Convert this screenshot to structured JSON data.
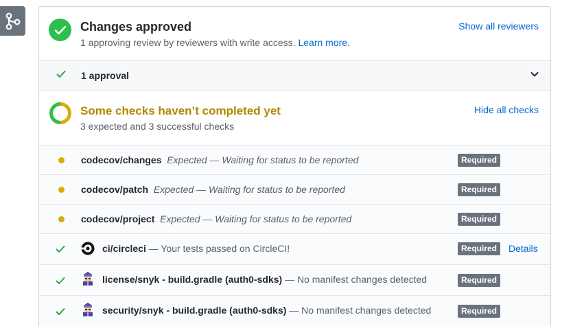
{
  "approved": {
    "title": "Changes approved",
    "subtitle": "1 approving review by reviewers with write access.",
    "learn_more": "Learn more.",
    "action": "Show all reviewers"
  },
  "approvals": {
    "label": "1 approval"
  },
  "checks": {
    "title": "Some checks haven’t completed yet",
    "subtitle": "3 expected and 3 successful checks",
    "action": "Hide all checks",
    "items": [
      {
        "status": "pending",
        "name": "codecov/changes",
        "desc": "Expected — Waiting for status to be reported",
        "badge": "Required"
      },
      {
        "status": "pending",
        "name": "codecov/patch",
        "desc": "Expected — Waiting for status to be reported",
        "badge": "Required"
      },
      {
        "status": "pending",
        "name": "codecov/project",
        "desc": "Expected — Waiting for status to be reported",
        "badge": "Required"
      },
      {
        "status": "success",
        "icon": "circleci-icon",
        "name": "ci/circleci",
        "desc": "— Your tests passed on CircleCI!",
        "badge": "Required",
        "link": "Details"
      },
      {
        "status": "success",
        "icon": "snyk-icon",
        "name": "license/snyk - build.gradle (auth0-sdks)",
        "desc": "— No manifest changes detected",
        "badge": "Required"
      },
      {
        "status": "success",
        "icon": "snyk-icon",
        "name": "security/snyk - build.gradle (auth0-sdks)",
        "desc": "— No manifest changes detected",
        "badge": "Required"
      }
    ]
  },
  "colors": {
    "success": "#2cbe4e",
    "pending": "#dbab09",
    "link": "#0366d6",
    "badge": "#6a737d"
  }
}
